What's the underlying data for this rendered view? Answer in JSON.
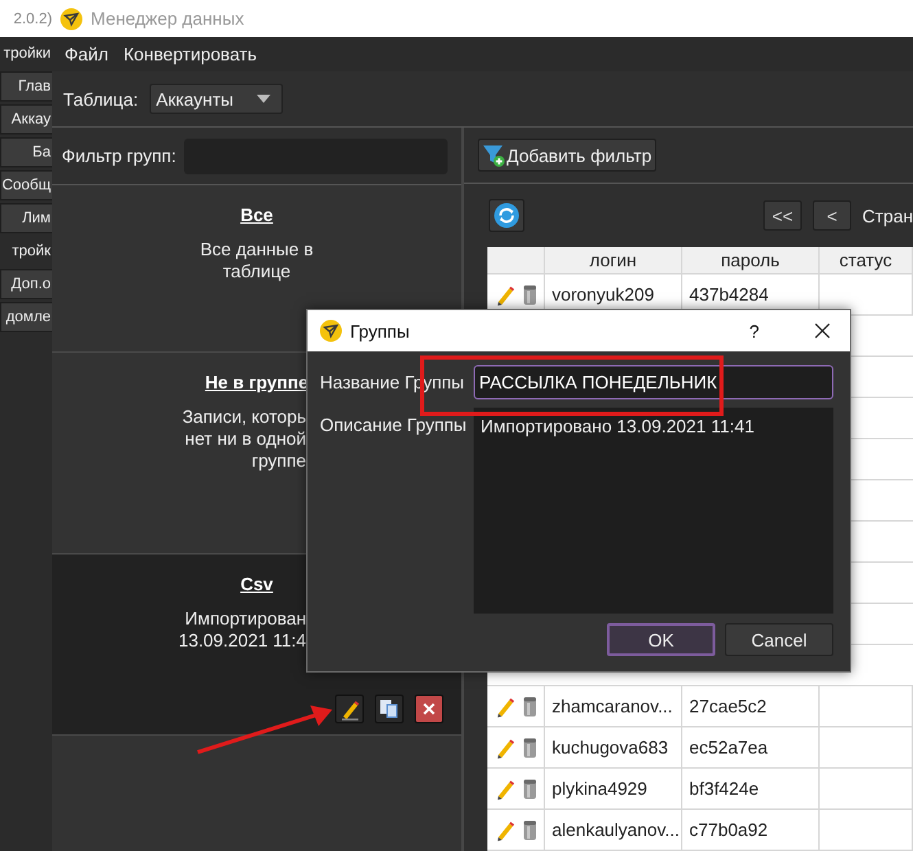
{
  "background_window": {
    "title": "2.0.2)",
    "sidebar": [
      {
        "label": "тройки",
        "kind": "header"
      },
      {
        "label": "Глав",
        "kind": "button"
      },
      {
        "label": "Аккау",
        "kind": "button"
      },
      {
        "label": "Ба",
        "kind": "button"
      },
      {
        "label": "Сообщ",
        "kind": "button"
      },
      {
        "label": "Лим",
        "kind": "button"
      },
      {
        "label": "тройк",
        "kind": "header"
      },
      {
        "label": "Доп.о",
        "kind": "button"
      },
      {
        "label": "домле",
        "kind": "button"
      }
    ]
  },
  "window": {
    "title": "Менеджер данных"
  },
  "menu": [
    "Файл",
    "Конвертировать"
  ],
  "toolbar": {
    "table_label": "Таблица:",
    "table_value": "Аккаунты"
  },
  "group_filter": {
    "label": "Фильтр групп:"
  },
  "groups": [
    {
      "name": "Все",
      "description": [
        "Все данные в",
        "таблице"
      ],
      "selected": false
    },
    {
      "name": "Не в группе",
      "description": [
        "Записи, которь",
        "нет ни в одной",
        "группе"
      ],
      "selected": false
    },
    {
      "name": "Csv",
      "description": [
        "Импортирован",
        "13.09.2021 11:4"
      ],
      "selected": true
    }
  ],
  "add_filter_button": "Добавить фильтр",
  "pager": {
    "first": "<<",
    "prev": "<",
    "label": "Стран"
  },
  "table": {
    "columns": [
      "логин",
      "пароль",
      "статус"
    ],
    "rows": [
      {
        "login": "voronyuk209",
        "password": "437b4284"
      },
      {
        "login": "zhamcaranov...",
        "password": "27cae5c2"
      },
      {
        "login": "kuchugova683",
        "password": "ec52a7ea"
      },
      {
        "login": "plykina4929",
        "password": "bf3f424e"
      },
      {
        "login": "alenkaulyanov...",
        "password": "c77b0a92"
      }
    ]
  },
  "dialog": {
    "title": "Группы",
    "help": "?",
    "name_label": "Название Группы",
    "name_value": "РАССЫЛКА ПОНЕДЕЛЬНИК",
    "description_label": "Описание Группы",
    "description_value": "Импортировано 13.09.2021 11:41",
    "buttons": [
      {
        "label": "OK",
        "default": true
      },
      {
        "label": "Cancel",
        "default": false
      }
    ]
  },
  "annotations": {
    "highlight_frame": true,
    "arrow": true
  }
}
